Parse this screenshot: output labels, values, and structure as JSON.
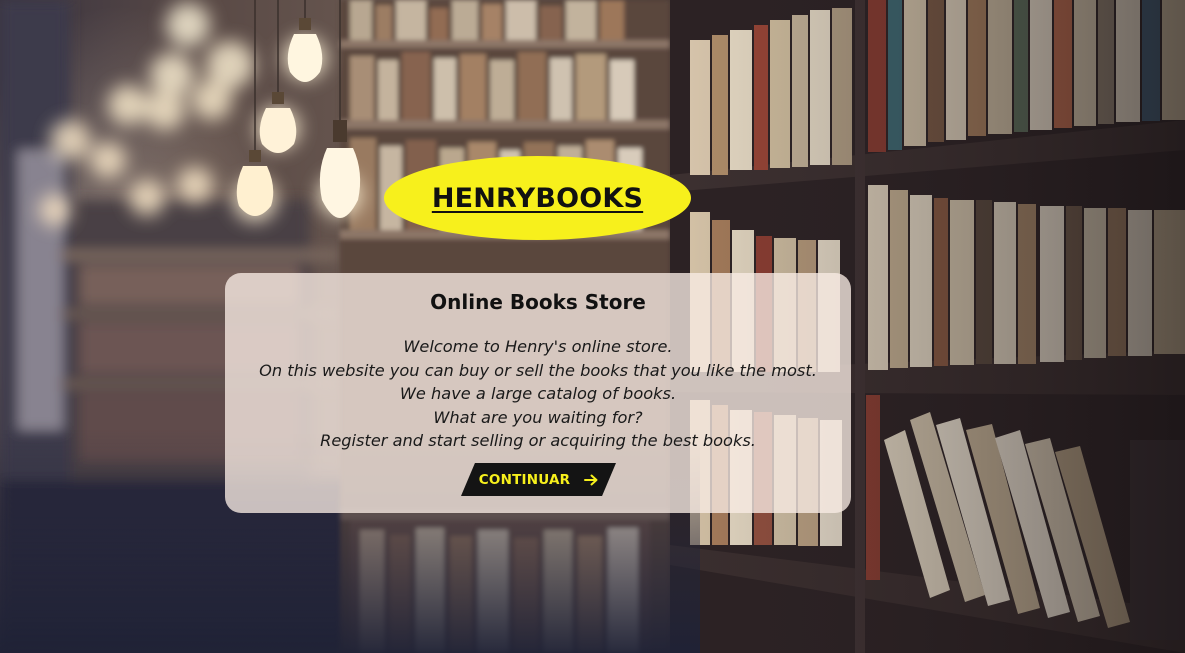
{
  "logo": {
    "text": "HENRYBOOKS"
  },
  "card": {
    "title": "Online Books Store",
    "lines": [
      "Welcome to Henry's online store.",
      "On this website you can buy or sell the books that you like the most.",
      "We have a large catalog of books.",
      "What are you waiting for?",
      "Register and start selling or acquiring the best books."
    ],
    "button_label": "CONTINUAR",
    "button_icon": "arrow-right-icon"
  },
  "colors": {
    "logo_bg": "#f7f01c",
    "button_bg": "#141414",
    "button_text": "#f7f01c",
    "card_bg": "rgba(248,236,228,0.78)"
  }
}
